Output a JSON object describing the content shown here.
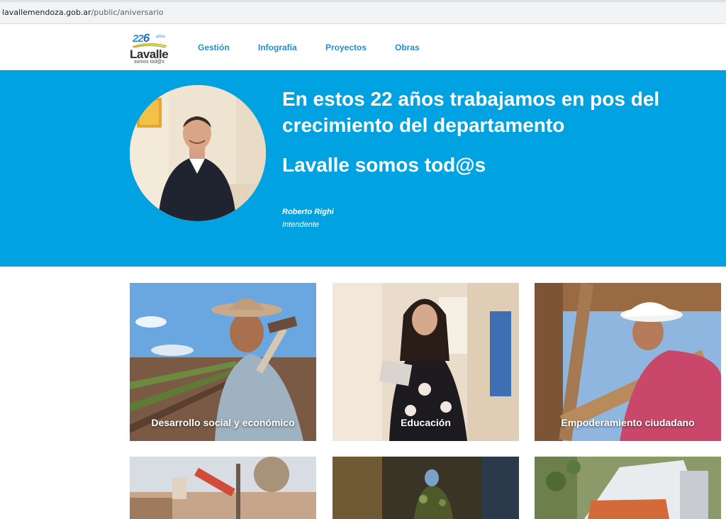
{
  "browser": {
    "url_domain": "lavallemendoza.gob.ar",
    "url_path": "/public/aniversario"
  },
  "header": {
    "logo": {
      "number": "22",
      "number_six": "6",
      "anios": "años",
      "word": "Lavalle",
      "tagline": "somos tod@s"
    },
    "nav": [
      "Gestión",
      "Infografía",
      "Proyectos",
      "Obras"
    ]
  },
  "hero": {
    "headline": "En estos 22 años trabajamos en pos del crecimiento del departamento",
    "subhead": "Lavalle somos tod@s",
    "author": "Roberto Righi",
    "role": "Intendente",
    "background": "#01a2e1"
  },
  "cards": [
    {
      "label": "Desarrollo social y económico"
    },
    {
      "label": "Educación"
    },
    {
      "label": "Empoderamiento ciudadano"
    },
    {
      "label": ""
    },
    {
      "label": ""
    },
    {
      "label": ""
    }
  ],
  "colors": {
    "accent": "#01a2e1",
    "nav_text": "#1f8fd3"
  }
}
